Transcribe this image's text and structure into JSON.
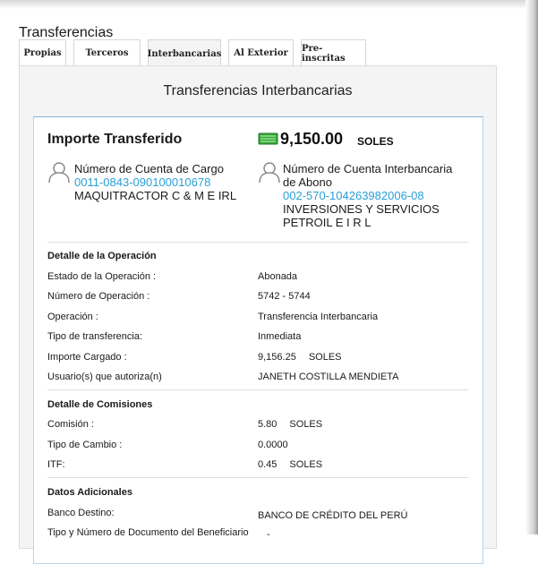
{
  "page": {
    "title": "Transferencias"
  },
  "tabs": [
    {
      "label": "Propias"
    },
    {
      "label": "Terceros"
    },
    {
      "label": "Interbancarias"
    },
    {
      "label": "Al Exterior"
    },
    {
      "label": "Pre-inscritas"
    }
  ],
  "active_tab": "Interbancarias",
  "panel": {
    "title": "Transferencias Interbancarias"
  },
  "summary": {
    "importe_label": "Importe Transferido",
    "amount": "9,150.00",
    "currency": "SOLES",
    "money_icon": "money-icon",
    "money_color": "#3aa63a"
  },
  "cargo": {
    "label": "Número de Cuenta de Cargo",
    "number": "0011-0843-090100010678",
    "holder": "MAQUITRACTOR C & M E IRL",
    "icon": "user-icon"
  },
  "abono": {
    "label_line1": "Número de Cuenta Interbancaria",
    "label_line2": "de Abono",
    "number": "002-570-104263982006-08",
    "holder_line1": "INVERSIONES Y SERVICIOS",
    "holder_line2": "PETROIL E I R L",
    "icon": "user-icon"
  },
  "link_color": "#2a9fd6",
  "operacion": {
    "title": "Detalle de la Operación",
    "rows": [
      {
        "label": "Estado de la Operación :",
        "value": "Abonada",
        "unit": ""
      },
      {
        "label": "Número de Operación :",
        "value": "5742 - 5744",
        "unit": ""
      },
      {
        "label": "Operación :",
        "value": "Transferencia Interbancaria",
        "unit": ""
      },
      {
        "label": "Tipo de transferencia:",
        "value": "Inmediata",
        "unit": ""
      },
      {
        "label": "Importe Cargado :",
        "value": "9,156.25",
        "unit": "SOLES"
      },
      {
        "label": "Usuario(s) que autoriza(n)",
        "value": "JANETH COSTILLA MENDIETA",
        "unit": ""
      }
    ]
  },
  "comisiones": {
    "title": "Detalle de Comisiones",
    "rows": [
      {
        "label": "Comisión :",
        "value": "5.80",
        "unit": "SOLES"
      },
      {
        "label": "Tipo de Cambio :",
        "value": "0.0000",
        "unit": ""
      },
      {
        "label": "ITF:",
        "value": "0.45",
        "unit": "SOLES"
      }
    ]
  },
  "adicionales": {
    "title": "Datos Adicionales",
    "rows": [
      {
        "label": "Banco Destino:",
        "value": "BANCO DE CRÉDITO DEL PERÚ",
        "unit": ""
      },
      {
        "label": "Tipo y Número de Documento del Beneficiario",
        "value": "-",
        "unit": ""
      }
    ]
  }
}
